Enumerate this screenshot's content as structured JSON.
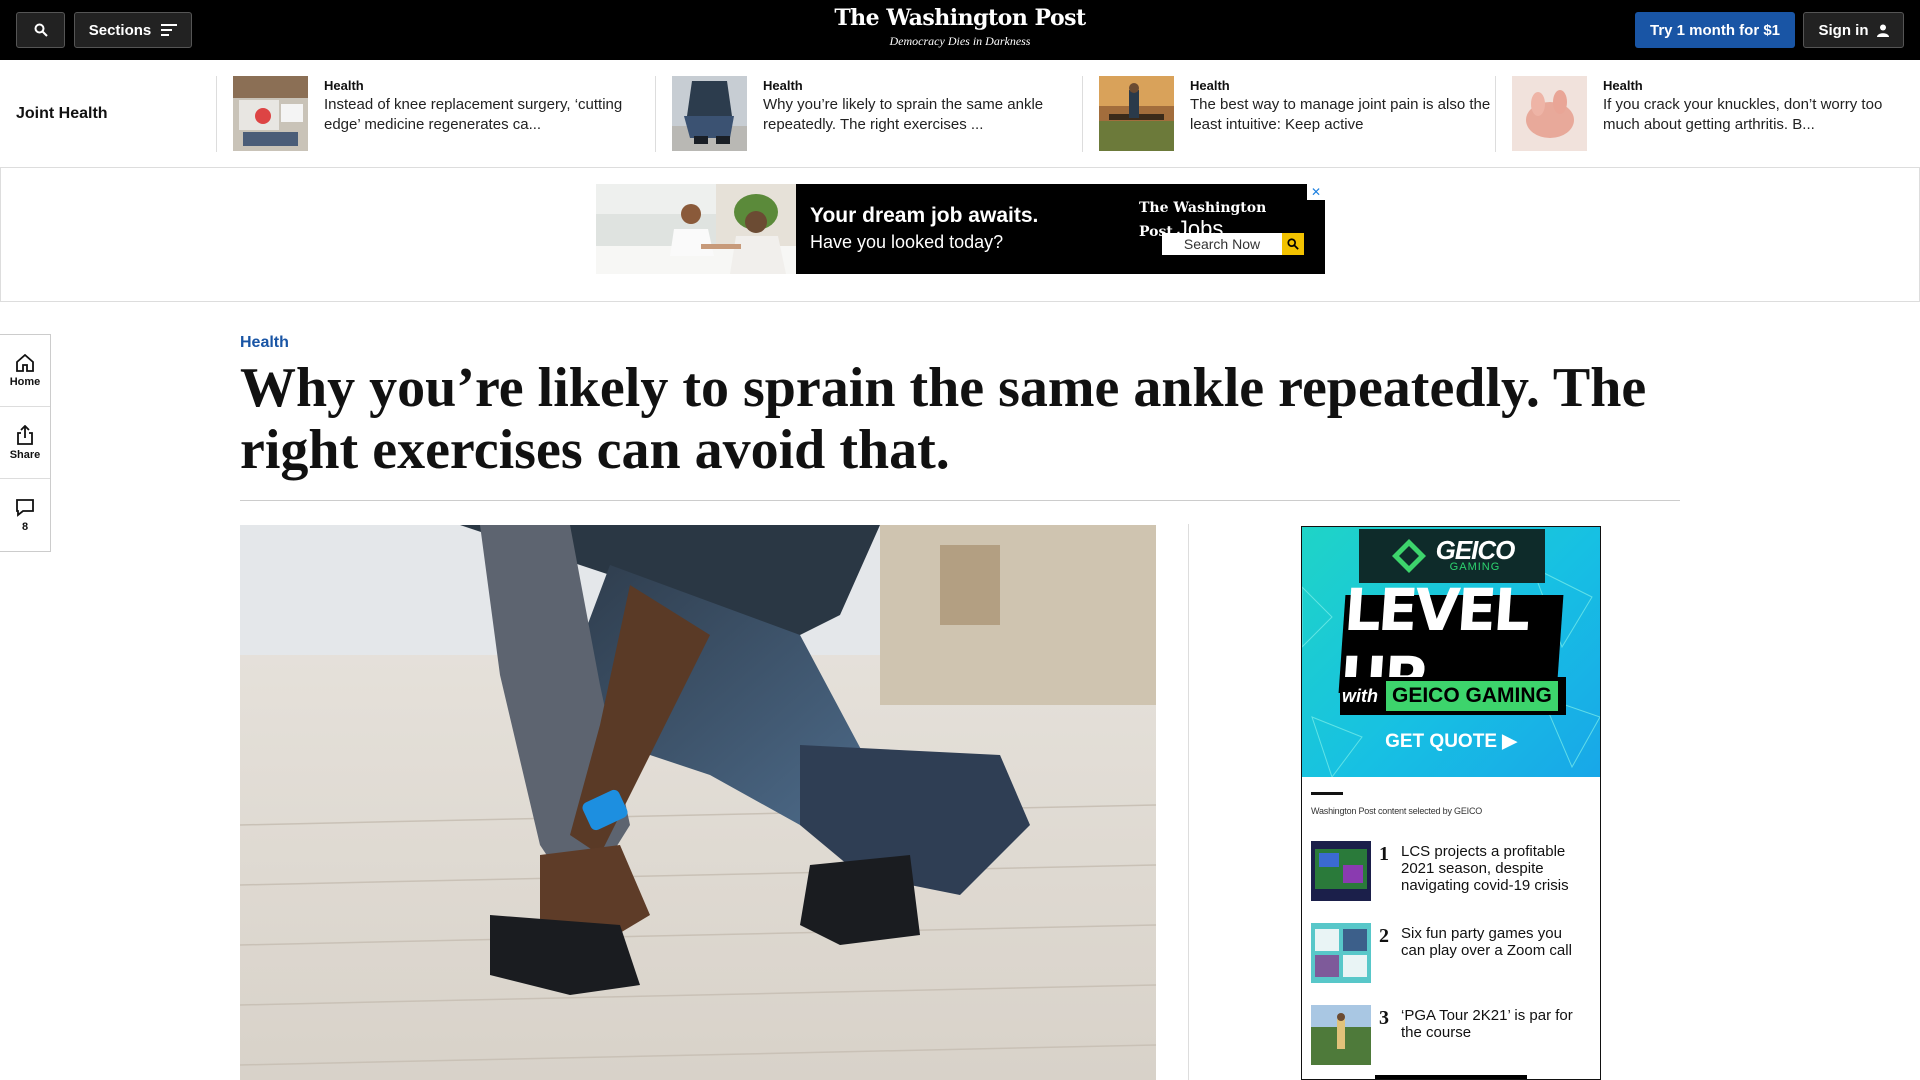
{
  "topbar": {
    "sections_label": "Sections",
    "logo": "The Washington Post",
    "tagline": "Democracy Dies in Darkness",
    "subscribe_label": "Try 1 month for $1",
    "signin_label": "Sign in",
    "icons": [
      "search-icon",
      "menu-icon",
      "person-icon"
    ]
  },
  "related": {
    "title": "Joint Health",
    "items": [
      {
        "kicker": "Health",
        "headline": "Instead of knee replacement surgery, ‘cutting edge’ medicine regenerates ca..."
      },
      {
        "kicker": "Health",
        "headline": "Why you’re likely to sprain the same ankle repeatedly. The right exercises ..."
      },
      {
        "kicker": "Health",
        "headline": "The best way to manage joint pain is also the least intuitive: Keep active"
      },
      {
        "kicker": "Health",
        "headline": "If you crack your knuckles, don’t worry too much about getting arthritis. B..."
      }
    ]
  },
  "banner_ad": {
    "headline": "Your dream job awaits.",
    "subhead": "Have you looked today?",
    "brand": "The Washington Post",
    "brand_suffix": "Jobs",
    "search_label": "Search Now",
    "close_glyph": "✕"
  },
  "rail": {
    "home_label": "Home",
    "share_label": "Share",
    "comments_count": "8"
  },
  "article": {
    "kicker": "Health",
    "title": "Why you’re likely to sprain the same ankle repeatedly. The right exercises can avoid that."
  },
  "side_ad": {
    "brand": "GEICO",
    "brand_sub": "GAMING",
    "level_up": "LEVEL UP",
    "with": "with",
    "with_brand": "GEICO GAMING",
    "cta": "GET QUOTE ▶",
    "selected_by": "Washington Post content selected by GEICO",
    "items": [
      {
        "num": "1",
        "text": "LCS projects a profitable 2021 season, despite navigating covid-19 crisis"
      },
      {
        "num": "2",
        "text": "Six fun party games you can play over a Zoom call"
      },
      {
        "num": "3",
        "text": "‘PGA Tour 2K21’ is par for the course"
      }
    ]
  },
  "colors": {
    "topbar_bg": "#000000",
    "accent_blue": "#1955a5",
    "geico_teal": "#17c0e3",
    "geico_green": "#3dd46c"
  }
}
